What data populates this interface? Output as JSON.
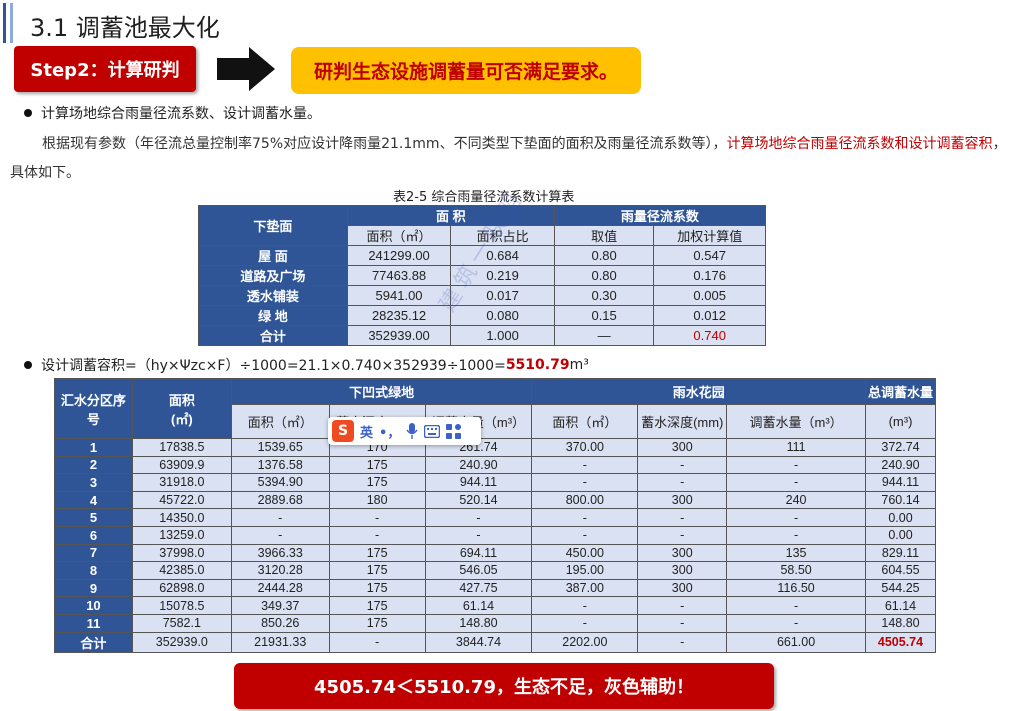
{
  "title": "3.1 调蓄池最大化",
  "step_label": "Step2：计算研判",
  "goal_text": "研判生态设施调蓄量可否满足要求。",
  "bullet1": "计算场地综合雨量径流系数、设计调蓄水量。",
  "para_normal": "根据现有参数（年径流总量控制率75%对应设计降雨量21.1mm、不同类型下垫面的面积及雨量径流系数等），",
  "para_red": "计算场地综合雨量径流系数和设计调蓄容积",
  "para_end": "，具体如下。",
  "table1": {
    "caption": "表2-5 综合雨量径流系数计算表",
    "h_surface": "下垫面",
    "h_area": "面  积",
    "h_coef": "雨量径流系数",
    "sub": [
      "面积（㎡）",
      "面积占比",
      "取值",
      "加权计算值"
    ],
    "rows": [
      {
        "label": "屋  面",
        "area": "241299.00",
        "ratio": "0.684",
        "value": "0.80",
        "weighted": "0.547"
      },
      {
        "label": "道路及广场",
        "area": "77463.88",
        "ratio": "0.219",
        "value": "0.80",
        "weighted": "0.176"
      },
      {
        "label": "透水铺装",
        "area": "5941.00",
        "ratio": "0.017",
        "value": "0.30",
        "weighted": "0.005"
      },
      {
        "label": "绿  地",
        "area": "28235.12",
        "ratio": "0.080",
        "value": "0.15",
        "weighted": "0.012"
      }
    ],
    "total": {
      "label": "合计",
      "area": "352939.00",
      "ratio": "1.000",
      "value": "—",
      "weighted": "0.740"
    }
  },
  "bullet2_pre": "设计调蓄容积=（hy×Ψzc×F）÷1000=21.1×0.740×352939÷1000=",
  "bullet2_val": "5510.79",
  "bullet2_unit": "m³",
  "table2": {
    "h_zone": "汇水分区序号",
    "h_area": "面积",
    "h_area_unit": "(㎡)",
    "h_sunken": "下凹式绿地",
    "h_rain": "雨水花园",
    "h_total": "总调蓄水量",
    "h_total_unit": "(m³)",
    "sub": [
      "面积（㎡）",
      "蓄水深度(mm)",
      "调蓄水量（m³）",
      "面积（㎡）",
      "蓄水深度(mm)",
      "调蓄水量（m³）"
    ],
    "rows": [
      [
        "1",
        "17838.5",
        "1539.65",
        "170",
        "261.74",
        "370.00",
        "300",
        "111",
        "372.74"
      ],
      [
        "2",
        "63909.9",
        "1376.58",
        "175",
        "240.90",
        "-",
        "-",
        "-",
        "240.90"
      ],
      [
        "3",
        "31918.0",
        "5394.90",
        "175",
        "944.11",
        "-",
        "-",
        "-",
        "944.11"
      ],
      [
        "4",
        "45722.0",
        "2889.68",
        "180",
        "520.14",
        "800.00",
        "300",
        "240",
        "760.14"
      ],
      [
        "5",
        "14350.0",
        "-",
        "-",
        "-",
        "-",
        "-",
        "-",
        "0.00"
      ],
      [
        "6",
        "13259.0",
        "-",
        "-",
        "-",
        "-",
        "-",
        "-",
        "0.00"
      ],
      [
        "7",
        "37998.0",
        "3966.33",
        "175",
        "694.11",
        "450.00",
        "300",
        "135",
        "829.11"
      ],
      [
        "8",
        "42385.0",
        "3120.28",
        "175",
        "546.05",
        "195.00",
        "300",
        "58.50",
        "604.55"
      ],
      [
        "9",
        "62898.0",
        "2444.28",
        "175",
        "427.75",
        "387.00",
        "300",
        "116.50",
        "544.25"
      ],
      [
        "10",
        "15078.5",
        "349.37",
        "175",
        "61.14",
        "-",
        "-",
        "-",
        "61.14"
      ],
      [
        "11",
        "7582.1",
        "850.26",
        "175",
        "148.80",
        "-",
        "-",
        "-",
        "148.80"
      ]
    ],
    "total": [
      "合计",
      "352939.0",
      "21931.33",
      "-",
      "3844.74",
      "2202.00",
      "-",
      "661.00",
      "4505.74"
    ]
  },
  "ime": {
    "logo": "S",
    "lang": "英",
    "punct": "•，"
  },
  "watermark": "建筑一联盟",
  "result_text": "4505.74＜5510.79，生态不足，灰色辅助！",
  "colors": {
    "accent_red": "#c00000",
    "header_blue": "#2f5597",
    "cell_fill": "#dae1f2",
    "goal_yellow": "#ffc000"
  }
}
